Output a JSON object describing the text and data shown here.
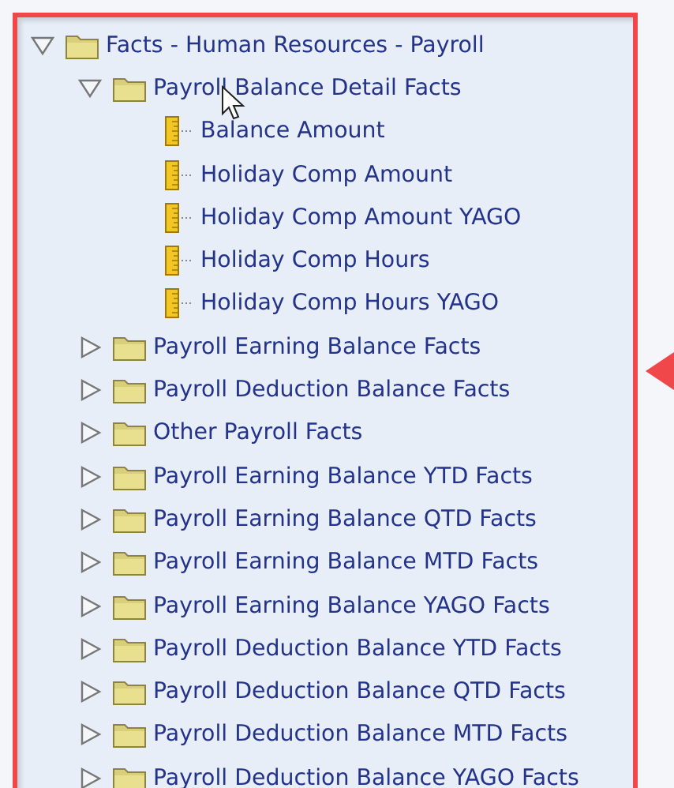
{
  "tree": [
    {
      "label": "Facts - Human Resources - Payroll",
      "kind": "folder",
      "expanded": true,
      "children": [
        {
          "label": "Payroll Balance Detail Facts",
          "kind": "folder",
          "expanded": true,
          "children": [
            {
              "label": "Balance Amount",
              "kind": "measure"
            },
            {
              "label": "Holiday Comp Amount",
              "kind": "measure"
            },
            {
              "label": "Holiday Comp Amount YAGO",
              "kind": "measure"
            },
            {
              "label": "Holiday Comp Hours",
              "kind": "measure"
            },
            {
              "label": "Holiday Comp Hours YAGO",
              "kind": "measure"
            }
          ]
        },
        {
          "label": "Payroll Earning Balance Facts",
          "kind": "folder",
          "expanded": false
        },
        {
          "label": "Payroll Deduction Balance Facts",
          "kind": "folder",
          "expanded": false
        },
        {
          "label": "Other Payroll Facts",
          "kind": "folder",
          "expanded": false
        },
        {
          "label": "Payroll Earning Balance YTD Facts",
          "kind": "folder",
          "expanded": false
        },
        {
          "label": "Payroll Earning Balance QTD Facts",
          "kind": "folder",
          "expanded": false
        },
        {
          "label": "Payroll Earning Balance MTD Facts",
          "kind": "folder",
          "expanded": false
        },
        {
          "label": "Payroll Earning Balance YAGO Facts",
          "kind": "folder",
          "expanded": false
        },
        {
          "label": "Payroll Deduction Balance YTD Facts",
          "kind": "folder",
          "expanded": false
        },
        {
          "label": "Payroll Deduction Balance QTD Facts",
          "kind": "folder",
          "expanded": false
        },
        {
          "label": "Payroll Deduction Balance MTD Facts",
          "kind": "folder",
          "expanded": false
        },
        {
          "label": "Payroll Deduction Balance YAGO Facts",
          "kind": "folder",
          "expanded": false
        }
      ]
    }
  ]
}
